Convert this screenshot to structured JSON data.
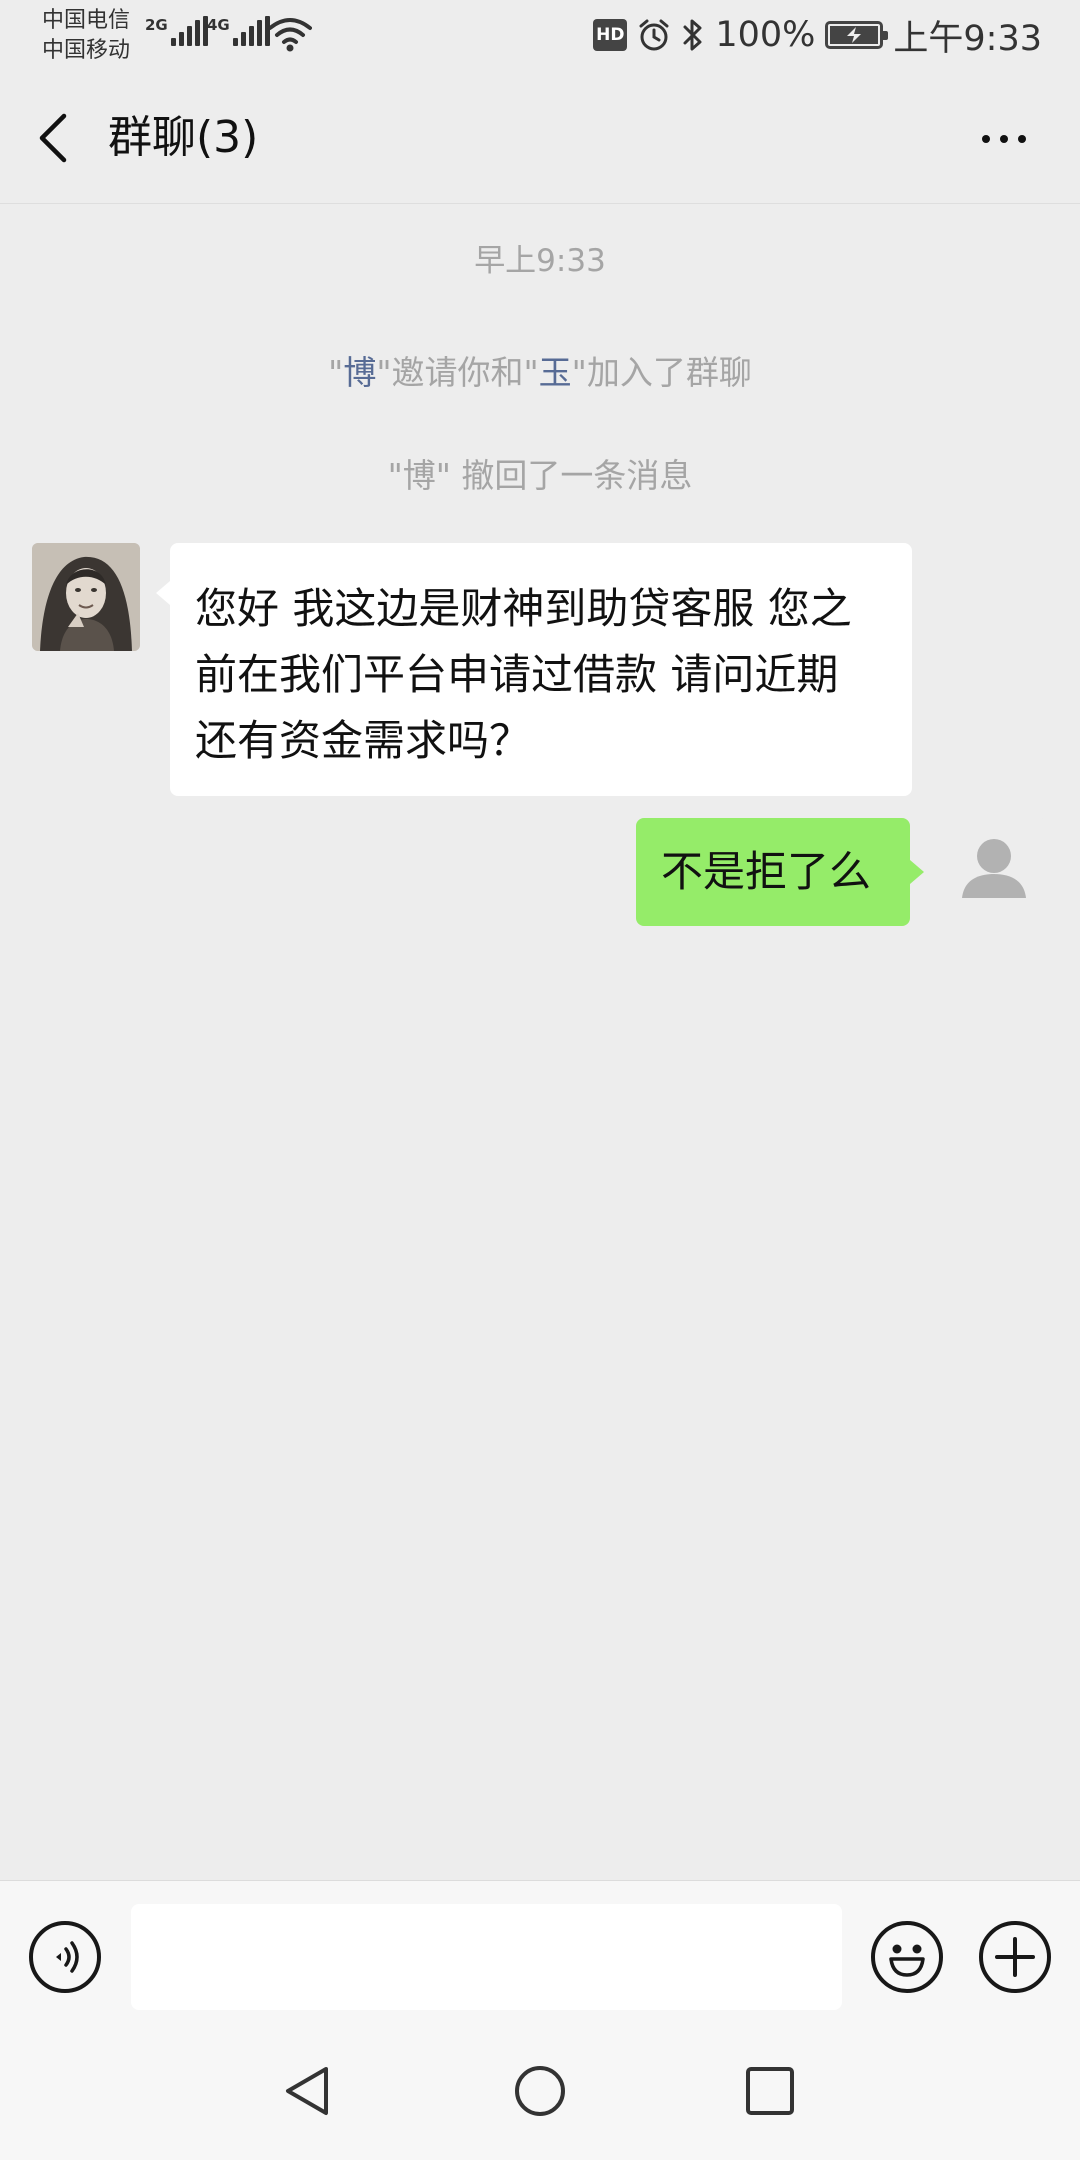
{
  "status_bar": {
    "carrier_1": "中国电信",
    "carrier_2": "中国移动",
    "network_1": "2G",
    "network_2": "4G",
    "hd_badge": "HD",
    "battery_text": "100%",
    "time": "上午9:33",
    "battery_level": 1.0
  },
  "header": {
    "title": "群聊(3)",
    "back_icon": "chevron-left-icon",
    "more_icon": "more-dots-icon"
  },
  "chat": {
    "timestamp": "早上9:33",
    "invite_notice": {
      "quote_open": "\"",
      "inviter": "博",
      "middle": "\"邀请你和\"",
      "invitee": "玉",
      "tail": "\"加入了群聊"
    },
    "recall_notice": "\"博\" 撤回了一条消息",
    "messages": [
      {
        "side": "left",
        "line_1": "您好 我这边是财神到助贷客服 您之",
        "line_2": "前在我们平台申请过借款 请问近期",
        "line_3": "还有资金需求吗？"
      },
      {
        "side": "right",
        "text": "不是拒了么"
      }
    ]
  },
  "input_bar": {
    "voice_icon": "voice-icon",
    "text_value": "",
    "emoji_icon": "emoji-icon",
    "plus_icon": "plus-icon"
  },
  "nav_bar": {
    "back_icon": "nav-back-icon",
    "home_icon": "nav-home-icon",
    "recents_icon": "nav-recents-icon"
  },
  "colors": {
    "background": "#ededed",
    "bubble_sent": "#95ec69",
    "bubble_received": "#ffffff",
    "system_text": "#a5a5a5",
    "name_link": "#576b95"
  }
}
